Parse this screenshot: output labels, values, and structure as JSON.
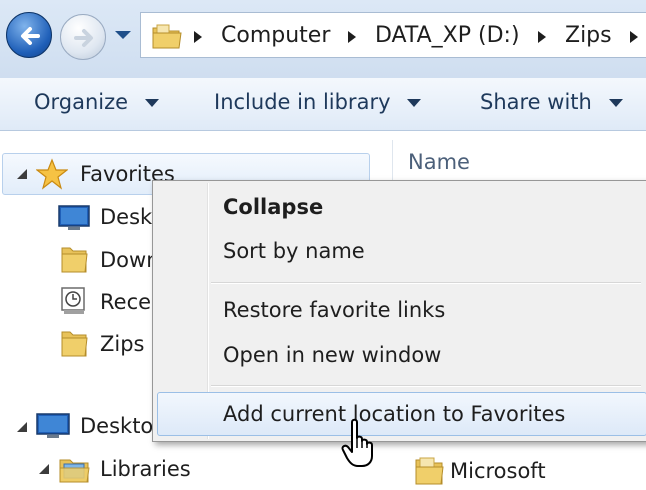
{
  "address_bar": {
    "crumbs": [
      "Computer",
      "DATA_XP (D:)",
      "Zips"
    ]
  },
  "toolbar": {
    "organize": "Organize",
    "include_in_library": "Include in library",
    "share_with": "Share with"
  },
  "nav_pane": {
    "favorites": "Favorites",
    "items": [
      "Deskt",
      "Down",
      "Rece",
      "Zips"
    ],
    "desktop": "Deskto",
    "libraries": "Libraries"
  },
  "content": {
    "column_name": "Name",
    "folder": "Microsoft"
  },
  "context_menu": {
    "items": [
      "Collapse",
      "Sort by name",
      "Restore favorite links",
      "Open in new window",
      "Add current location to Favorites"
    ]
  },
  "colors": {
    "accent": "#1f5fb8",
    "highlight_border": "#9bbfe6",
    "folder": "#e8c25a"
  }
}
